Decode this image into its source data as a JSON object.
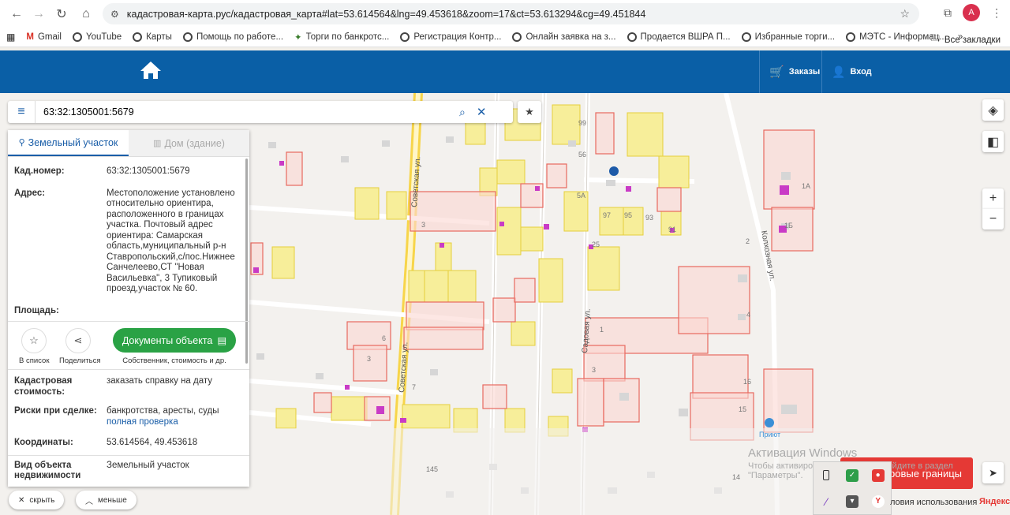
{
  "browser": {
    "url": "кадастровая-карта.рус/кадастровая_карта#lat=53.614564&lng=49.453618&zoom=17&ct=53.613294&cg=49.451844",
    "profile_initial": "A",
    "bookmarks": [
      {
        "label": "Gmail"
      },
      {
        "label": "YouTube"
      },
      {
        "label": "Карты"
      },
      {
        "label": "Помощь по работе..."
      },
      {
        "label": "Торги по банкротс..."
      },
      {
        "label": "Регистрация Контр..."
      },
      {
        "label": "Онлайн заявка на з..."
      },
      {
        "label": "Продается ВШРА П..."
      },
      {
        "label": "Избранные торги..."
      },
      {
        "label": "МЭТС - Информац..."
      }
    ],
    "more_bookmarks": "»",
    "all_bookmarks": "Все закладки"
  },
  "header": {
    "orders_label": "Заказы",
    "login_label": "Вход"
  },
  "search": {
    "value": "63:32:1305001:5679"
  },
  "panel": {
    "tab_land": "Земельный участок",
    "tab_building": "Дом (здание)",
    "cad_number_label": "Кад.номер:",
    "cad_number_value": "63:32:1305001:5679",
    "address_label": "Адрес:",
    "address_value": "Местоположение установлено относительно ориентира, расположенного в границах участка. Почтовый адрес ориентира: Самарская область,муниципальный р-н Ставропольский,с/пос.Нижнее Санчелеево,СТ \"Новая Васильевка\", 3 Тупиковый проезд,участок № 60.",
    "area_label": "Площадь:",
    "to_list_label": "В список",
    "share_label": "Поделиться",
    "docs_button": "Документы объекта",
    "docs_sub": "Собственник, стоимость и др.",
    "cad_cost_label": "Кадастровая стоимость:",
    "cad_cost_link": "заказать справку на дату",
    "risks_label": "Риски при сделке:",
    "risks_value": "банкротства, аресты, суды",
    "risks_link": "полная проверка",
    "coords_label": "Координаты:",
    "coords_value": "53.614564, 49.453618",
    "type_label": "Вид объекта недвижимости",
    "type_value": "Земельный участок"
  },
  "bottom": {
    "hide_label": "скрыть",
    "less_label": "меньше",
    "boundaries_button": "ровые границы",
    "terms": "ловия использования",
    "yandex": "Яндекс"
  },
  "watermark": {
    "title": "Активация Windows",
    "sub": "Чтобы активировать Windows, перейдите в раздел \"Параметры\"."
  },
  "map": {
    "streets": [
      "Советская ул.",
      "Советская ул.",
      "Садовая ул.",
      "Колхозная ул."
    ],
    "numbers": [
      "99",
      "56",
      "5А",
      "97",
      "95",
      "93",
      "91",
      "1А",
      "1Б",
      "2",
      "4",
      "1",
      "3",
      "16",
      "15",
      "14",
      "3",
      "6",
      "7",
      "3",
      "145",
      "25"
    ],
    "poi": "Приют",
    "colors": {
      "parcel_red": "#e8695f",
      "parcel_fill": "#fbd7d2",
      "parcel_yellow": "#f7ee9a",
      "building": "#d4d4d4",
      "road_main": "#f7d54a",
      "purple": "#c93bc6"
    }
  }
}
